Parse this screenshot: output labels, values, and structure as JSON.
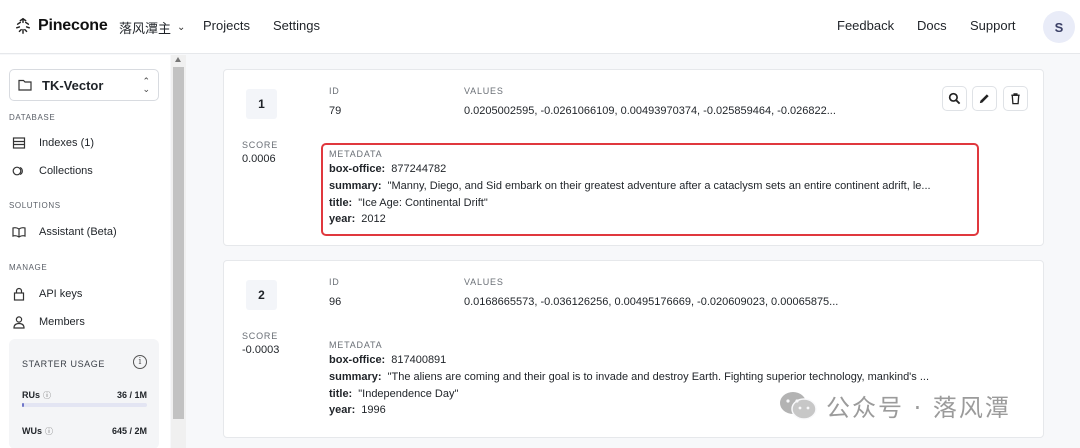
{
  "app": {
    "logo_text": "Pinecone",
    "org_name": "落风潭主",
    "nav": [
      "Projects",
      "Settings"
    ],
    "right_nav": [
      "Feedback",
      "Docs",
      "Support"
    ],
    "avatar_initial": "S"
  },
  "sidebar": {
    "project_name": "TK-Vector",
    "sections": {
      "database": "DATABASE",
      "solutions": "SOLUTIONS",
      "manage": "MANAGE"
    },
    "items": {
      "indexes": "Indexes (1)",
      "collections": "Collections",
      "assistant": "Assistant (Beta)",
      "api_keys": "API keys",
      "members": "Members"
    },
    "usage": {
      "title": "STARTER USAGE",
      "rus_label": "RUs",
      "rus_value": "36 / 1M",
      "rus_fraction": 3.6e-05,
      "wus_label": "WUs",
      "wus_value": "645 / 2M",
      "wus_fraction": 0.0003
    }
  },
  "labels": {
    "id": "ID",
    "values": "VALUES",
    "score": "SCORE",
    "metadata": "METADATA",
    "box_office": "box-office:",
    "summary": "summary:",
    "title": "title:",
    "year": "year:"
  },
  "results": [
    {
      "rank": "1",
      "id": "79",
      "values": "0.0205002595, -0.0261066109, 0.00493970374, -0.025859464, -0.026822...",
      "score": "0.0006",
      "box_office": "877244782",
      "summary": "\"Manny, Diego, and Sid embark on their greatest adventure after a cataclysm sets an entire continent adrift, le...",
      "title": "\"Ice Age: Continental Drift\"",
      "year": "2012"
    },
    {
      "rank": "2",
      "id": "96",
      "values": "0.0168665573, -0.036126256, 0.00495176669, -0.020609023, 0.00065875...",
      "score": "-0.0003",
      "box_office": "817400891",
      "summary": "\"The aliens are coming and their goal is to invade and destroy Earth. Fighting superior technology, mankind's ...",
      "title": "\"Independence Day\"",
      "year": "1996"
    }
  ],
  "watermark": "公众号 · 落风潭",
  "colors": {
    "highlight_box": "#e0383e",
    "usage_fill": "#6f76c9"
  }
}
